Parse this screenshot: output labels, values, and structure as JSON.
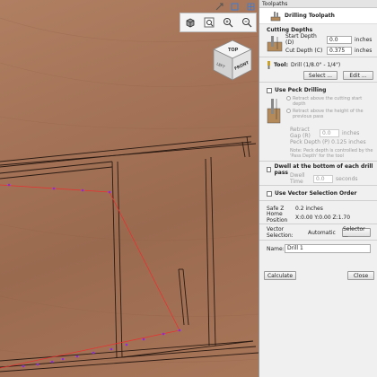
{
  "panel": {
    "title": "Toolpaths",
    "toolpath_name": "Drilling Toolpath",
    "cutting_depths": {
      "title": "Cutting Depths",
      "start_label": "Start Depth (D)",
      "start_value": "0.0",
      "cut_label": "Cut Depth (C)",
      "cut_value": "0.375",
      "unit": "inches"
    },
    "tool": {
      "label": "Tool:",
      "value": "Drill (1/8.0\" - 1/4\")",
      "select_label": "Select ...",
      "edit_label": "Edit ..."
    },
    "peck": {
      "title": "Use Peck Drilling",
      "opt1": "Retract above the cutting start depth",
      "opt2": "Retract above the height of the previous pass",
      "retract_label": "Retract Gap (R)",
      "retract_value": "0.0",
      "retract_unit": "inches",
      "peck_depth_text": "Peck Depth (P)  0.125 inches",
      "note": "Note: Peck depth is controlled by the 'Pass Depth' for the tool"
    },
    "dwell": {
      "title": "Dwell at the bottom of each drill pass",
      "time_label": "Dwell Time",
      "time_value": "0.0",
      "time_unit": "seconds"
    },
    "vector": {
      "title": "Use Vector Selection Order"
    },
    "info": {
      "safe_z_label": "Safe Z",
      "safe_z_value": "0.2 inches",
      "home_label": "Home Position",
      "home_value": "X:0.00 Y:0.00 Z:1.70"
    },
    "selection": {
      "label": "Vector Selection:",
      "value": "Automatic",
      "button": "Selector ..."
    },
    "name": {
      "label": "Name:",
      "value": "Drill 1"
    },
    "calculate_label": "Calculate",
    "close_label": "Close"
  },
  "cube": {
    "top": "TOP",
    "left": "LEFT",
    "front": "FRONT"
  },
  "colors": {
    "wood": "#a57458",
    "panel": "#f0f0f0",
    "toolpath": "#e83030",
    "drill_points": "#8a2be2"
  }
}
